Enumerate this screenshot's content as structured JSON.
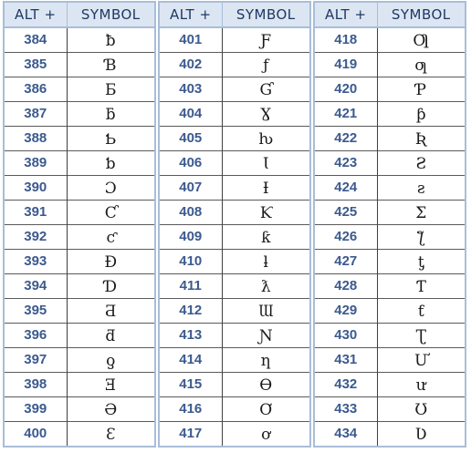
{
  "headers": {
    "alt": "ALT +",
    "symbol": "SYMBOL"
  },
  "colors": {
    "header_bg": "#dce6f2",
    "header_text": "#1f3864",
    "alt_code_text": "#3b5a8e",
    "outer_border": "#a9bdd8"
  },
  "groups": [
    {
      "rows": [
        {
          "alt": "384",
          "symbol": "ƀ"
        },
        {
          "alt": "385",
          "symbol": "Ɓ"
        },
        {
          "alt": "386",
          "symbol": "Ƃ"
        },
        {
          "alt": "387",
          "symbol": "ƃ"
        },
        {
          "alt": "388",
          "symbol": "Ƅ"
        },
        {
          "alt": "389",
          "symbol": "ƅ"
        },
        {
          "alt": "390",
          "symbol": "Ɔ"
        },
        {
          "alt": "391",
          "symbol": "Ƈ"
        },
        {
          "alt": "392",
          "symbol": "ƈ"
        },
        {
          "alt": "393",
          "symbol": "Ɖ"
        },
        {
          "alt": "394",
          "symbol": "Ɗ"
        },
        {
          "alt": "395",
          "symbol": "Ƌ"
        },
        {
          "alt": "396",
          "symbol": "ƌ"
        },
        {
          "alt": "397",
          "symbol": "ƍ"
        },
        {
          "alt": "398",
          "symbol": "Ǝ"
        },
        {
          "alt": "399",
          "symbol": "Ə"
        },
        {
          "alt": "400",
          "symbol": "Ɛ"
        }
      ]
    },
    {
      "rows": [
        {
          "alt": "401",
          "symbol": "Ƒ"
        },
        {
          "alt": "402",
          "symbol": "ƒ"
        },
        {
          "alt": "403",
          "symbol": "Ɠ"
        },
        {
          "alt": "404",
          "symbol": "Ɣ"
        },
        {
          "alt": "405",
          "symbol": "ƕ"
        },
        {
          "alt": "406",
          "symbol": "Ɩ"
        },
        {
          "alt": "407",
          "symbol": "Ɨ"
        },
        {
          "alt": "408",
          "symbol": "Ƙ"
        },
        {
          "alt": "409",
          "symbol": "ƙ"
        },
        {
          "alt": "410",
          "symbol": "ƚ"
        },
        {
          "alt": "411",
          "symbol": "ƛ"
        },
        {
          "alt": "412",
          "symbol": "Ɯ"
        },
        {
          "alt": "413",
          "symbol": "Ɲ"
        },
        {
          "alt": "414",
          "symbol": "ƞ"
        },
        {
          "alt": "415",
          "symbol": "Ɵ"
        },
        {
          "alt": "416",
          "symbol": "Ơ"
        },
        {
          "alt": "417",
          "symbol": "ơ"
        }
      ]
    },
    {
      "rows": [
        {
          "alt": "418",
          "symbol": "Ƣ"
        },
        {
          "alt": "419",
          "symbol": "ƣ"
        },
        {
          "alt": "420",
          "symbol": "Ƥ"
        },
        {
          "alt": "421",
          "symbol": "ƥ"
        },
        {
          "alt": "422",
          "symbol": "Ʀ"
        },
        {
          "alt": "423",
          "symbol": "Ƨ"
        },
        {
          "alt": "424",
          "symbol": "ƨ"
        },
        {
          "alt": "425",
          "symbol": "Ʃ"
        },
        {
          "alt": "426",
          "symbol": "ƪ"
        },
        {
          "alt": "427",
          "symbol": "ƫ"
        },
        {
          "alt": "428",
          "symbol": "Ƭ"
        },
        {
          "alt": "429",
          "symbol": "ƭ"
        },
        {
          "alt": "430",
          "symbol": "Ʈ"
        },
        {
          "alt": "431",
          "symbol": "Ư"
        },
        {
          "alt": "432",
          "symbol": "ư"
        },
        {
          "alt": "433",
          "symbol": "Ʊ"
        },
        {
          "alt": "434",
          "symbol": "Ʋ"
        }
      ]
    }
  ]
}
